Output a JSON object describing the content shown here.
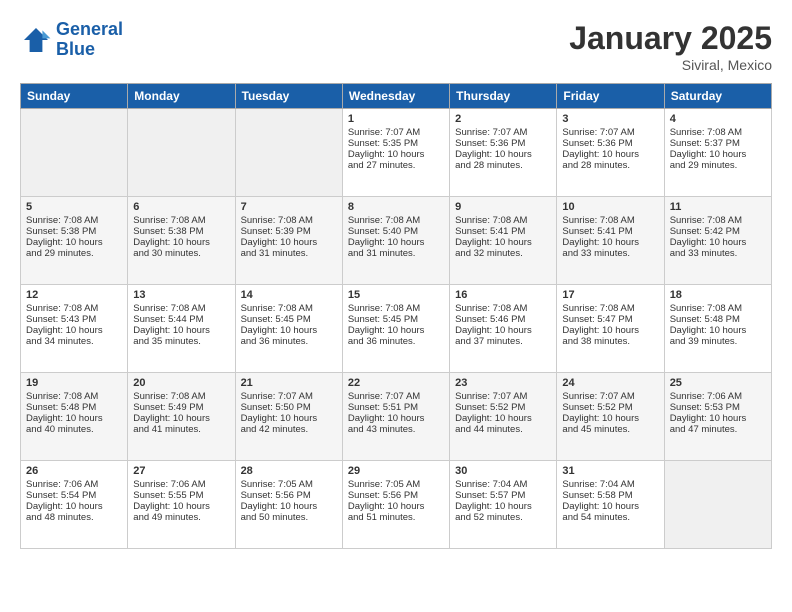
{
  "header": {
    "logo_line1": "General",
    "logo_line2": "Blue",
    "month": "January 2025",
    "location": "Siviral, Mexico"
  },
  "days_of_week": [
    "Sunday",
    "Monday",
    "Tuesday",
    "Wednesday",
    "Thursday",
    "Friday",
    "Saturday"
  ],
  "weeks": [
    [
      {
        "day": "",
        "info": ""
      },
      {
        "day": "",
        "info": ""
      },
      {
        "day": "",
        "info": ""
      },
      {
        "day": "1",
        "info": "Sunrise: 7:07 AM\nSunset: 5:35 PM\nDaylight: 10 hours\nand 27 minutes."
      },
      {
        "day": "2",
        "info": "Sunrise: 7:07 AM\nSunset: 5:36 PM\nDaylight: 10 hours\nand 28 minutes."
      },
      {
        "day": "3",
        "info": "Sunrise: 7:07 AM\nSunset: 5:36 PM\nDaylight: 10 hours\nand 28 minutes."
      },
      {
        "day": "4",
        "info": "Sunrise: 7:08 AM\nSunset: 5:37 PM\nDaylight: 10 hours\nand 29 minutes."
      }
    ],
    [
      {
        "day": "5",
        "info": "Sunrise: 7:08 AM\nSunset: 5:38 PM\nDaylight: 10 hours\nand 29 minutes."
      },
      {
        "day": "6",
        "info": "Sunrise: 7:08 AM\nSunset: 5:38 PM\nDaylight: 10 hours\nand 30 minutes."
      },
      {
        "day": "7",
        "info": "Sunrise: 7:08 AM\nSunset: 5:39 PM\nDaylight: 10 hours\nand 31 minutes."
      },
      {
        "day": "8",
        "info": "Sunrise: 7:08 AM\nSunset: 5:40 PM\nDaylight: 10 hours\nand 31 minutes."
      },
      {
        "day": "9",
        "info": "Sunrise: 7:08 AM\nSunset: 5:41 PM\nDaylight: 10 hours\nand 32 minutes."
      },
      {
        "day": "10",
        "info": "Sunrise: 7:08 AM\nSunset: 5:41 PM\nDaylight: 10 hours\nand 33 minutes."
      },
      {
        "day": "11",
        "info": "Sunrise: 7:08 AM\nSunset: 5:42 PM\nDaylight: 10 hours\nand 33 minutes."
      }
    ],
    [
      {
        "day": "12",
        "info": "Sunrise: 7:08 AM\nSunset: 5:43 PM\nDaylight: 10 hours\nand 34 minutes."
      },
      {
        "day": "13",
        "info": "Sunrise: 7:08 AM\nSunset: 5:44 PM\nDaylight: 10 hours\nand 35 minutes."
      },
      {
        "day": "14",
        "info": "Sunrise: 7:08 AM\nSunset: 5:45 PM\nDaylight: 10 hours\nand 36 minutes."
      },
      {
        "day": "15",
        "info": "Sunrise: 7:08 AM\nSunset: 5:45 PM\nDaylight: 10 hours\nand 36 minutes."
      },
      {
        "day": "16",
        "info": "Sunrise: 7:08 AM\nSunset: 5:46 PM\nDaylight: 10 hours\nand 37 minutes."
      },
      {
        "day": "17",
        "info": "Sunrise: 7:08 AM\nSunset: 5:47 PM\nDaylight: 10 hours\nand 38 minutes."
      },
      {
        "day": "18",
        "info": "Sunrise: 7:08 AM\nSunset: 5:48 PM\nDaylight: 10 hours\nand 39 minutes."
      }
    ],
    [
      {
        "day": "19",
        "info": "Sunrise: 7:08 AM\nSunset: 5:48 PM\nDaylight: 10 hours\nand 40 minutes."
      },
      {
        "day": "20",
        "info": "Sunrise: 7:08 AM\nSunset: 5:49 PM\nDaylight: 10 hours\nand 41 minutes."
      },
      {
        "day": "21",
        "info": "Sunrise: 7:07 AM\nSunset: 5:50 PM\nDaylight: 10 hours\nand 42 minutes."
      },
      {
        "day": "22",
        "info": "Sunrise: 7:07 AM\nSunset: 5:51 PM\nDaylight: 10 hours\nand 43 minutes."
      },
      {
        "day": "23",
        "info": "Sunrise: 7:07 AM\nSunset: 5:52 PM\nDaylight: 10 hours\nand 44 minutes."
      },
      {
        "day": "24",
        "info": "Sunrise: 7:07 AM\nSunset: 5:52 PM\nDaylight: 10 hours\nand 45 minutes."
      },
      {
        "day": "25",
        "info": "Sunrise: 7:06 AM\nSunset: 5:53 PM\nDaylight: 10 hours\nand 47 minutes."
      }
    ],
    [
      {
        "day": "26",
        "info": "Sunrise: 7:06 AM\nSunset: 5:54 PM\nDaylight: 10 hours\nand 48 minutes."
      },
      {
        "day": "27",
        "info": "Sunrise: 7:06 AM\nSunset: 5:55 PM\nDaylight: 10 hours\nand 49 minutes."
      },
      {
        "day": "28",
        "info": "Sunrise: 7:05 AM\nSunset: 5:56 PM\nDaylight: 10 hours\nand 50 minutes."
      },
      {
        "day": "29",
        "info": "Sunrise: 7:05 AM\nSunset: 5:56 PM\nDaylight: 10 hours\nand 51 minutes."
      },
      {
        "day": "30",
        "info": "Sunrise: 7:04 AM\nSunset: 5:57 PM\nDaylight: 10 hours\nand 52 minutes."
      },
      {
        "day": "31",
        "info": "Sunrise: 7:04 AM\nSunset: 5:58 PM\nDaylight: 10 hours\nand 54 minutes."
      },
      {
        "day": "",
        "info": ""
      }
    ]
  ]
}
